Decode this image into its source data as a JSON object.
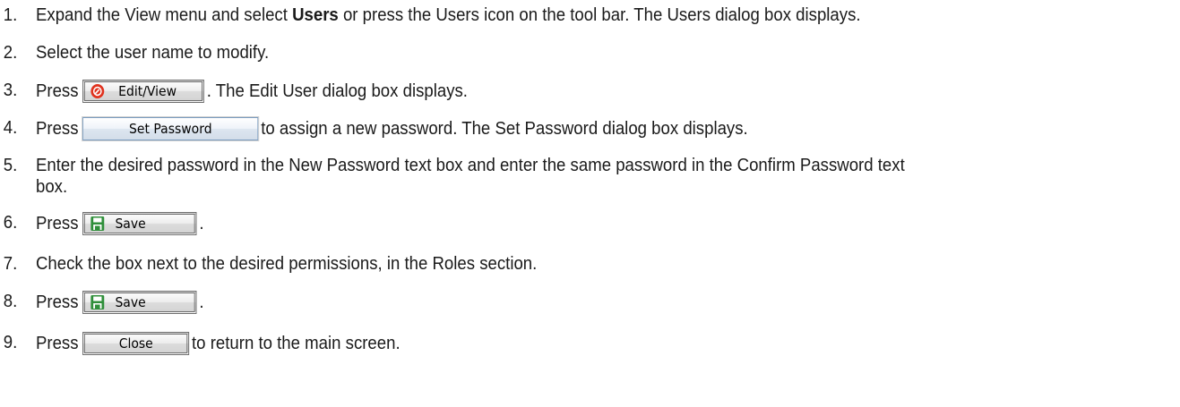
{
  "steps": [
    {
      "number": "1.",
      "text_before": "Expand the View menu and select ",
      "bold": "Users",
      "text_after": " or press the Users icon on the tool bar. The Users dialog box displays."
    },
    {
      "number": "2.",
      "text": "Select the user name to modify."
    },
    {
      "number": "3.",
      "text_before": "Press",
      "button_label": "Edit/View",
      "button_icon": "edit-view-icon",
      "text_after": ". The Edit User dialog box displays."
    },
    {
      "number": "4.",
      "text_before": "Press",
      "button_label": "Set Password",
      "text_after": "to assign a new password. The Set Password dialog box displays."
    },
    {
      "number": "5.",
      "text_line1": "Enter the desired password in the New Password text box and enter the same password in the Confirm Password text",
      "text_line2": "box."
    },
    {
      "number": "6.",
      "text_before": "Press",
      "button_label": "Save",
      "button_icon": "floppy-disk-icon",
      "text_after": "."
    },
    {
      "number": "7.",
      "text": "Check the box next to the desired permissions, in the Roles section."
    },
    {
      "number": "8.",
      "text_before": "Press",
      "button_label": "Save",
      "button_icon": "floppy-disk-icon",
      "text_after": "."
    },
    {
      "number": "9.",
      "text_before": "Press",
      "button_label": "Close",
      "text_after": "to return to the main screen."
    }
  ],
  "colors": {
    "text": "#1a1a1a",
    "edit_icon_red": "#e0321e",
    "save_icon_green": "#2f8f3a"
  }
}
